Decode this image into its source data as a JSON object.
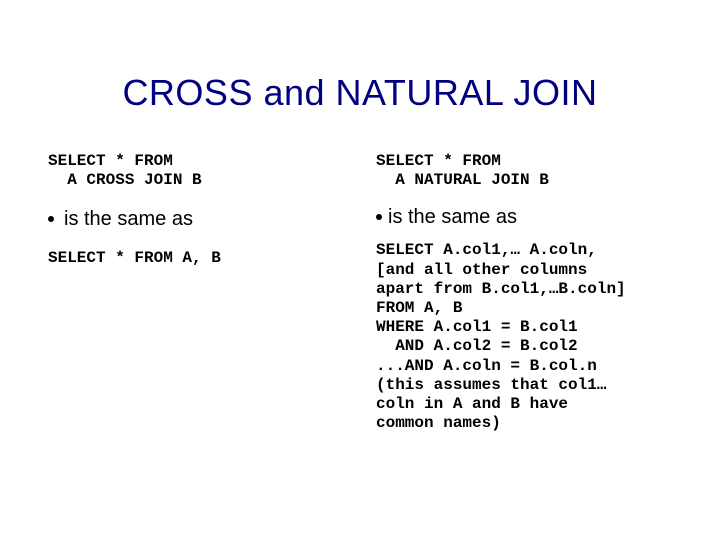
{
  "title": "CROSS and NATURAL JOIN",
  "left": {
    "code1": "SELECT * FROM\n  A CROSS JOIN B",
    "bullet": "is the same as",
    "code2": "SELECT * FROM A, B"
  },
  "right": {
    "code1": "SELECT * FROM\n  A NATURAL JOIN B",
    "bullet": "is the same as",
    "code2": "SELECT A.col1,… A.coln,\n[and all other columns\napart from B.col1,…B.coln]\nFROM A, B\nWHERE A.col1 = B.col1\n  AND A.col2 = B.col2\n...AND A.coln = B.col.n\n(this assumes that col1…\ncoln in A and B have\ncommon names)"
  }
}
